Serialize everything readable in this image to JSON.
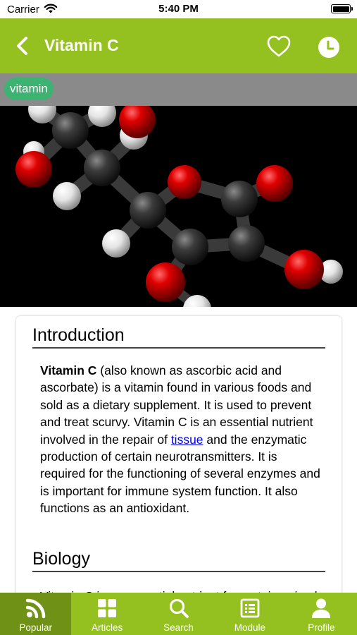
{
  "status_bar": {
    "carrier": "Carrier",
    "time": "5:40 PM"
  },
  "nav": {
    "title": "Vitamin C",
    "back_icon": "chevron-left-icon",
    "favorite_icon": "heart-outline-icon",
    "history_icon": "clock-icon"
  },
  "tag": {
    "label": "vitamin"
  },
  "article": {
    "intro_heading": "Introduction",
    "intro_bold": "Vitamin C",
    "intro_text_1": " (also known as ascorbic acid and ascorbate) is a vitamin found in various foods and sold as a dietary supplement. It is used to prevent and treat scurvy. Vitamin C is an essential nutrient involved in the repair of ",
    "intro_link": "tissue",
    "intro_text_2": " and the enzymatic production of certain neurotransmitters. It is required for the functioning of several enzymes and is important for immune system function. It also functions as an antioxidant.",
    "biology_heading": "Biology",
    "biology_text": "Vitamin C is an essential nutrient for certain animals including humans."
  },
  "tabs": [
    {
      "label": "Popular",
      "icon": "rss-feed-icon",
      "active": true
    },
    {
      "label": "Articles",
      "icon": "grid-icon",
      "active": false
    },
    {
      "label": "Search",
      "icon": "search-icon",
      "active": false
    },
    {
      "label": "Module",
      "icon": "list-box-icon",
      "active": false
    },
    {
      "label": "Profile",
      "icon": "person-icon",
      "active": false
    }
  ],
  "colors": {
    "brand_green": "#94c11f",
    "active_tab": "#6f9116",
    "tag_green": "#3cb371",
    "tag_bar_gray": "#8a8a8a",
    "link_blue": "#0000ee"
  }
}
